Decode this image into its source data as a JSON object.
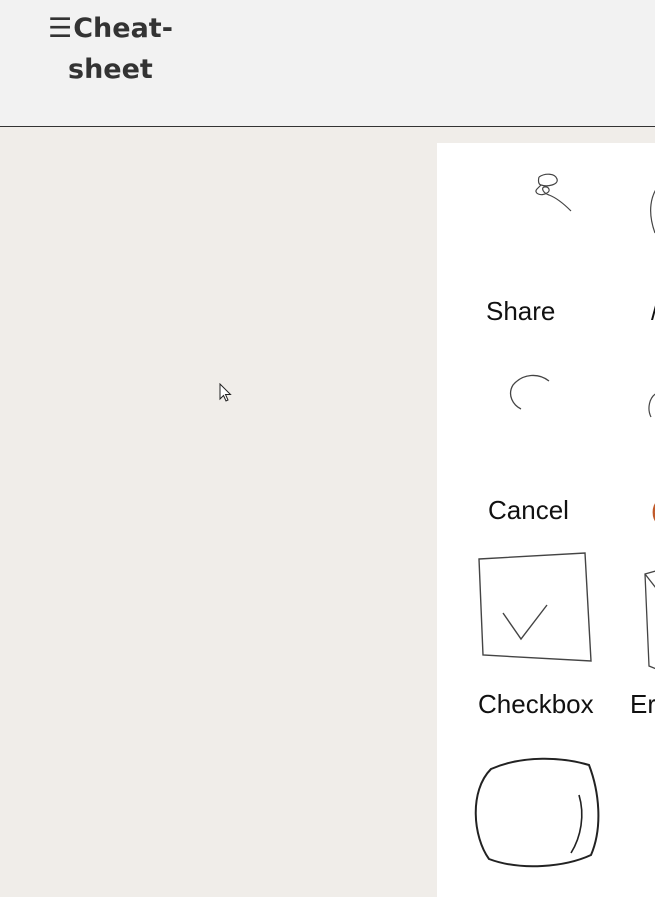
{
  "header": {
    "menu_icon": "hamburger-icon",
    "menu_glyph": "☰",
    "title_line1": "Cheat-",
    "title_line2": "sheet"
  },
  "sheet": {
    "items": [
      {
        "label": "Share",
        "icon": "share-sketch-icon"
      },
      {
        "label": "Cancel",
        "icon": "cancel-sketch-icon"
      },
      {
        "label": "Checkbox",
        "icon": "checkbox-sketch-icon"
      },
      {
        "label": "Er",
        "icon": "partial-sketch-icon"
      },
      {
        "label": "",
        "icon": "rounded-box-sketch-icon"
      }
    ]
  },
  "colors": {
    "page_background": "#f0ede9",
    "header_background": "#f2f2f2",
    "sheet_background": "#ffffff",
    "text": "#333333"
  }
}
